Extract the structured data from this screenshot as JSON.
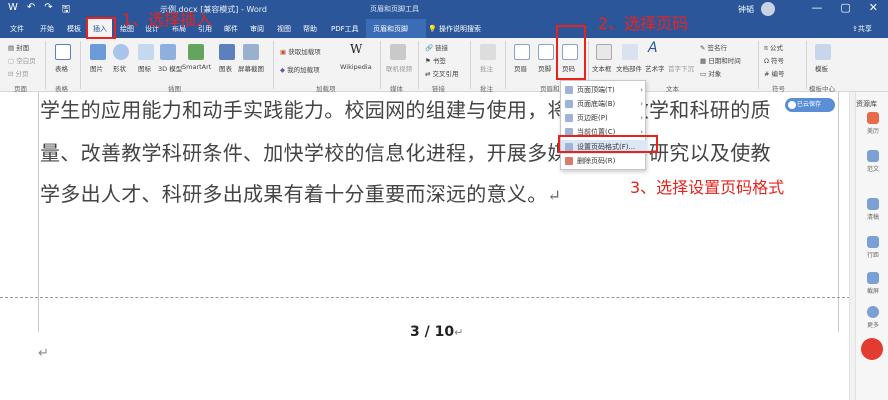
{
  "titlebar": {
    "title": "示例.docx [兼容模式] - Word",
    "context_tool": "页眉和页脚工具",
    "user": "钟韬",
    "qat": [
      "W",
      "↶",
      "↷",
      "🖫"
    ],
    "window_buttons": [
      "—",
      "▢",
      "✕"
    ]
  },
  "tabs": [
    "文件",
    "开始",
    "模板",
    "插入",
    "绘图",
    "设计",
    "布局",
    "引用",
    "邮件",
    "审阅",
    "视图",
    "帮助",
    "PDF工具",
    "页眉和页脚"
  ],
  "tell_me": "操作说明搜索",
  "share": "共享",
  "ribbon": {
    "page_group": {
      "items": [
        "封面",
        "空白页",
        "分页"
      ],
      "label": "页面"
    },
    "table": {
      "label": "表格",
      "group": "表格"
    },
    "illus": {
      "items": [
        "图片",
        "形状",
        "图标",
        "3D 模型",
        "SmartArt",
        "图表",
        "屏幕截图"
      ],
      "group": "插图"
    },
    "addins": {
      "get": "获取加载项",
      "mine": "我的加载项",
      "wiki": "Wikipedia",
      "group": "加载项"
    },
    "media": {
      "video": "联机视频",
      "group": "媒体"
    },
    "links": {
      "items": [
        "链接",
        "书签",
        "交叉引用"
      ],
      "group": "链接"
    },
    "comment": {
      "label": "批注",
      "group": "批注"
    },
    "hf": {
      "items": [
        "页眉",
        "页脚",
        "页码"
      ],
      "group": "页眉和页脚"
    },
    "text": {
      "items": [
        "文本框",
        "文档部件",
        "艺术字",
        "首字下沉"
      ],
      "right": [
        "签名行",
        "日期和时间",
        "对象"
      ],
      "group": "文本"
    },
    "symbols": {
      "items": [
        "公式",
        "符号",
        "编号"
      ],
      "group": "符号"
    },
    "template": {
      "label": "模板",
      "group": "模板中心"
    }
  },
  "dropdown": [
    {
      "label": "页面顶端(T)",
      "submenu": true
    },
    {
      "label": "页面底端(B)",
      "submenu": true
    },
    {
      "label": "页边距(P)",
      "submenu": true
    },
    {
      "label": "当前位置(C)",
      "submenu": true
    },
    {
      "label": "设置页码格式(F)...",
      "submenu": false
    },
    {
      "label": "删除页码(R)",
      "submenu": false
    }
  ],
  "doc": {
    "lines": [
      "学生的应用能力和动手实践能力。校园网的组建与使用，将会提高教学和科研的质",
      "量、改善教学科研条件、加快学校的信息化进程，开展多媒体教学与研究以及使教",
      "学多出人才、科研多出成果有着十分重要而深远的意义。"
    ],
    "para_mark": "↵",
    "page_number": "3 / 10"
  },
  "resource_pane": {
    "title": "资源库",
    "items": [
      "美历",
      "范文",
      "清稿",
      "行距",
      "截屏",
      "更多"
    ]
  },
  "cloud_badge": "已云保存",
  "annotations": {
    "step1": "1、选择插入",
    "step2": "2、选择页码",
    "step3": "3、选择设置页码格式"
  }
}
